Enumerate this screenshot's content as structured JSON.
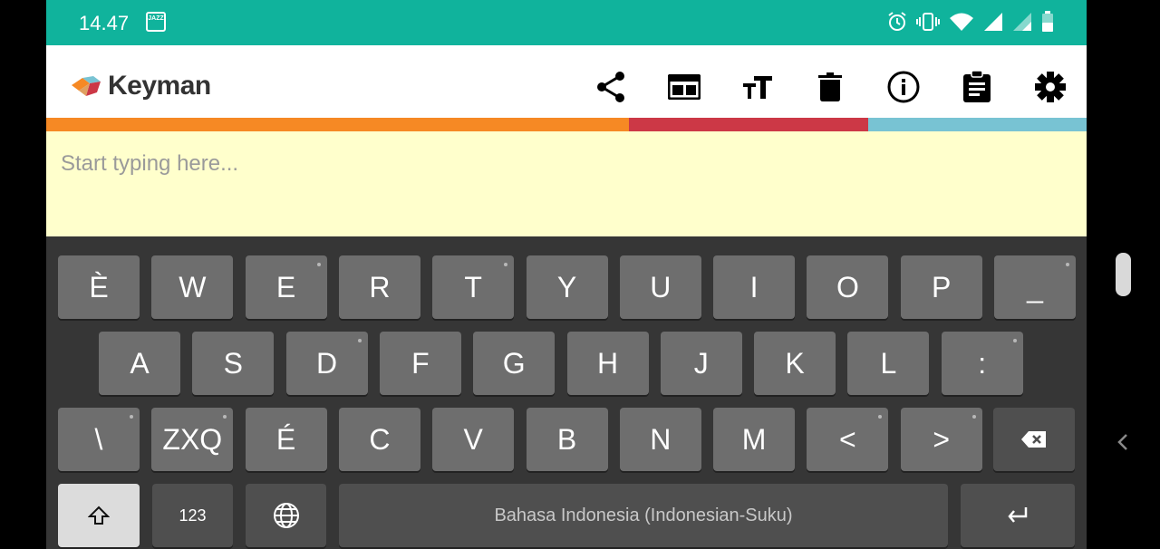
{
  "status_bar": {
    "time": "14.47",
    "carrier_label": "JAZZ",
    "icons": [
      "alarm-icon",
      "vibrate-icon",
      "wifi-icon",
      "signal-icon",
      "signal-icon-2",
      "battery-icon"
    ]
  },
  "app_bar": {
    "app_name": "Keyman",
    "actions": [
      "share-icon",
      "web-browser-icon",
      "text-size-icon",
      "delete-icon",
      "info-icon",
      "clipboard-icon",
      "settings-icon"
    ]
  },
  "colors": {
    "status_bar": "#10b39c",
    "stripe_orange": "#f68924",
    "stripe_red": "#cc3846",
    "stripe_blue": "#78c3d3",
    "text_area": "#ffffcc",
    "keyboard": "#363636",
    "key": "#6e6e6e"
  },
  "editor": {
    "placeholder": "Start typing here..."
  },
  "keyboard": {
    "row1": [
      {
        "label": "È",
        "dot": false
      },
      {
        "label": "W",
        "dot": false
      },
      {
        "label": "E",
        "dot": true
      },
      {
        "label": "R",
        "dot": false
      },
      {
        "label": "T",
        "dot": true
      },
      {
        "label": "Y",
        "dot": false
      },
      {
        "label": "U",
        "dot": false
      },
      {
        "label": "I",
        "dot": false
      },
      {
        "label": "O",
        "dot": false
      },
      {
        "label": "P",
        "dot": false
      },
      {
        "label": "_",
        "dot": true
      }
    ],
    "row2": [
      {
        "label": "A",
        "dot": false
      },
      {
        "label": "S",
        "dot": false
      },
      {
        "label": "D",
        "dot": true
      },
      {
        "label": "F",
        "dot": false
      },
      {
        "label": "G",
        "dot": false
      },
      {
        "label": "H",
        "dot": false
      },
      {
        "label": "J",
        "dot": false
      },
      {
        "label": "K",
        "dot": false
      },
      {
        "label": "L",
        "dot": false
      },
      {
        "label": ":",
        "dot": true
      }
    ],
    "row3": [
      {
        "label": "\\",
        "dot": true
      },
      {
        "label": "ZXQ",
        "dot": true
      },
      {
        "label": "É",
        "dot": false
      },
      {
        "label": "C",
        "dot": false
      },
      {
        "label": "V",
        "dot": false
      },
      {
        "label": "B",
        "dot": false
      },
      {
        "label": "N",
        "dot": false
      },
      {
        "label": "M",
        "dot": false
      },
      {
        "label": "<",
        "dot": true
      },
      {
        "label": ">",
        "dot": true
      }
    ],
    "backspace_icon": "backspace-icon",
    "shift_icon": "shift-icon",
    "numbers_label": "123",
    "globe_icon": "globe-icon",
    "spacebar_label": "Bahasa Indonesia (Indonesian-Suku)",
    "enter_icon": "enter-icon"
  },
  "navigation": {
    "back_icon": "chevron-left-icon"
  }
}
